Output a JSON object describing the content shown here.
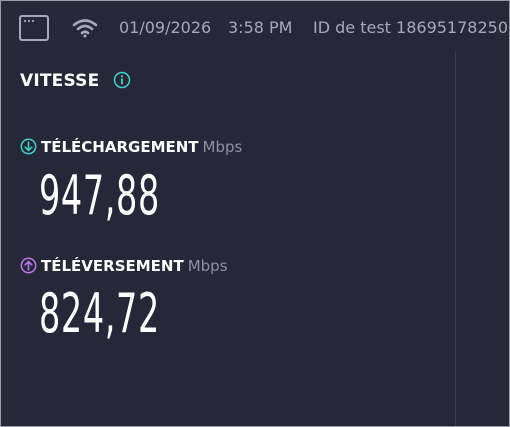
{
  "status_bar": {
    "window_icon": "browser-window-icon",
    "wifi_icon": "wifi-icon",
    "date": "01/09/2026",
    "time": "3:58 PM",
    "test_id": "ID de test 18695178250"
  },
  "speed": {
    "title": "VITESSE",
    "info_icon": "info-icon",
    "download": {
      "icon": "download-arrow-icon",
      "label": "TÉLÉCHARGEMENT",
      "unit": "Mbps",
      "value": "947,88",
      "accent_color": "#3fd1c7"
    },
    "upload": {
      "icon": "upload-arrow-icon",
      "label": "TÉLÉVERSEMENT",
      "unit": "Mbps",
      "value": "824,72",
      "accent_color": "#b77ae8"
    }
  },
  "colors": {
    "background": "#262739",
    "muted_text": "#a6a8bc",
    "info_accent": "#3fd1c7"
  }
}
